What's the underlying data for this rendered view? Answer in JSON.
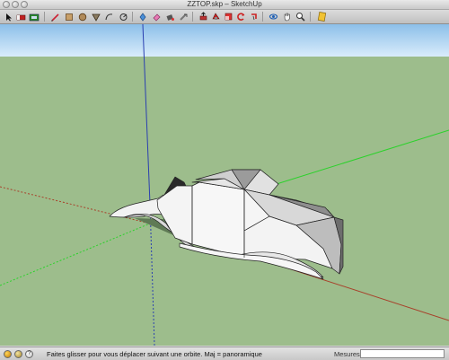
{
  "window": {
    "title": "ZZTOP.skp – SketchUp"
  },
  "toolbar": {
    "tools": [
      "select-arrow-icon",
      "eraser-paint-icon",
      "model-info-icon",
      "pencil-line-icon",
      "rectangle-icon",
      "circle-icon",
      "polygon-icon",
      "freehand-arc-icon",
      "move-icon",
      "eraser-icon",
      "paint-bucket-icon",
      "tape-measure-icon",
      "push-pull-icon",
      "offset-icon",
      "scale-icon",
      "rotate-icon",
      "follow-me-icon",
      "orbit-icon",
      "pan-icon",
      "zoom-icon",
      "layers-icon"
    ]
  },
  "status": {
    "message": "Faites glisser pour vous déplacer suivant une orbite.  Maj = panoramique",
    "measures_label": "Mesures",
    "measures_value": ""
  },
  "colors": {
    "sky_top": "#8cbfe9",
    "sky_bottom": "#d9ecfb",
    "ground": "#9dbd8c",
    "axis_blue": "#2a3fb0",
    "axis_green": "#2bd22b",
    "axis_red": "#a8402a"
  }
}
